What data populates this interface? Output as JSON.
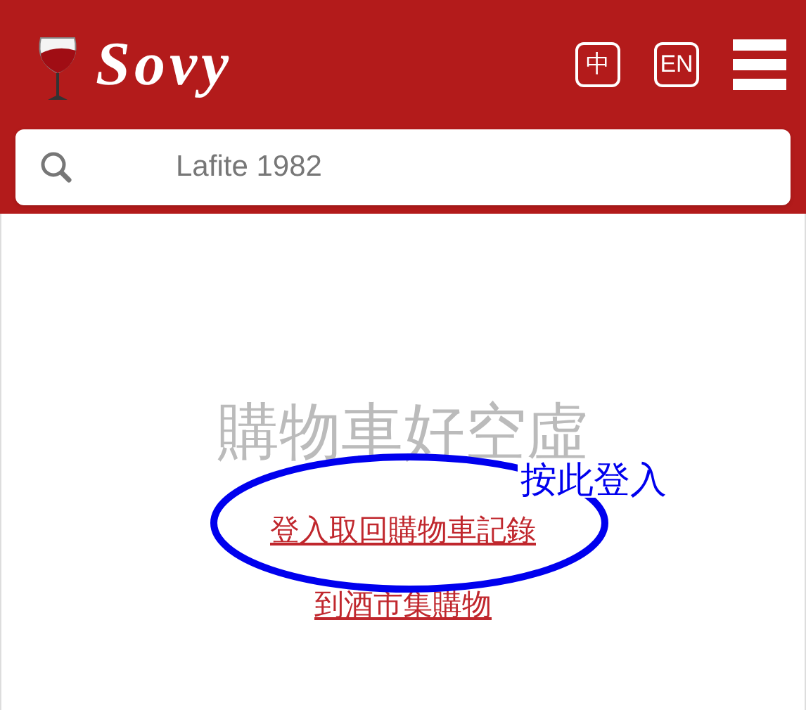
{
  "header": {
    "logo": "Sovy",
    "language_buttons": [
      {
        "label": "中"
      },
      {
        "label": "EN"
      }
    ]
  },
  "search": {
    "placeholder": "Lafite 1982"
  },
  "cart": {
    "empty_message": "購物車好空虛",
    "login_link": "登入取回購物車記錄",
    "shop_link": "到酒市集購物"
  },
  "annotation": {
    "text": "按此登入"
  }
}
